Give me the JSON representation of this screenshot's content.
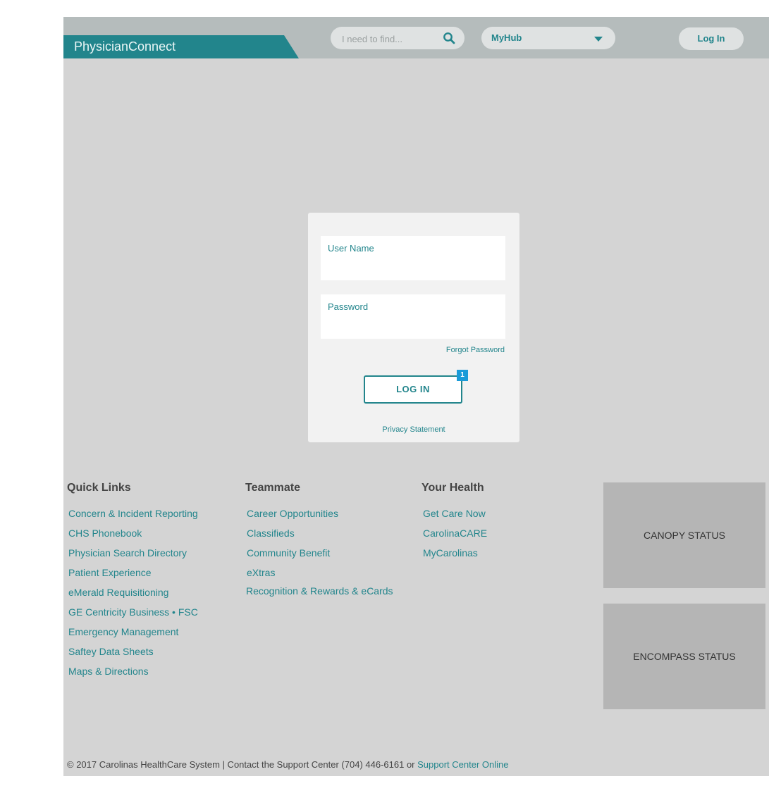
{
  "header": {
    "brand": "PhysicianConnect",
    "search_placeholder": "I need to find...",
    "hub_label": "MyHub",
    "login_label": "Log In"
  },
  "login_form": {
    "username_label": "User Name",
    "password_label": "Password",
    "forgot_label": "Forgot Password",
    "submit_label": "LOG IN",
    "badge": "1",
    "privacy_label": "Privacy Statement"
  },
  "quick_links": {
    "title": "Quick Links",
    "items": [
      "Concern & Incident Reporting",
      "CHS Phonebook",
      "Physician Search Directory",
      "Patient Experience",
      "eMerald Requisitioning",
      "GE Centricity Business • FSC",
      "Emergency Management",
      "Saftey Data Sheets",
      "Maps & Directions"
    ]
  },
  "teammate": {
    "title": "Teammate",
    "items": [
      "Career Opportunities",
      "Classifieds",
      "Community Benefit",
      "eXtras",
      "Recognition & Rewards & eCards"
    ]
  },
  "your_health": {
    "title": "Your Health",
    "items": [
      "Get Care Now",
      "CarolinaCARE",
      "MyCarolinas"
    ]
  },
  "status": {
    "canopy": "CANOPY STATUS",
    "encompass": "ENCOMPASS STATUS"
  },
  "footer": {
    "text": "© 2017 Carolinas HealthCare System | Contact the Support Center (704) 446-6161 or ",
    "link": "Support Center Online"
  },
  "colors": {
    "accent": "#22858c",
    "page_bg": "#d4d4d4",
    "header_bg": "#b5bcbc",
    "badge": "#1a9bd8"
  },
  "icons": [
    "search-icon",
    "chevron-down-icon"
  ]
}
